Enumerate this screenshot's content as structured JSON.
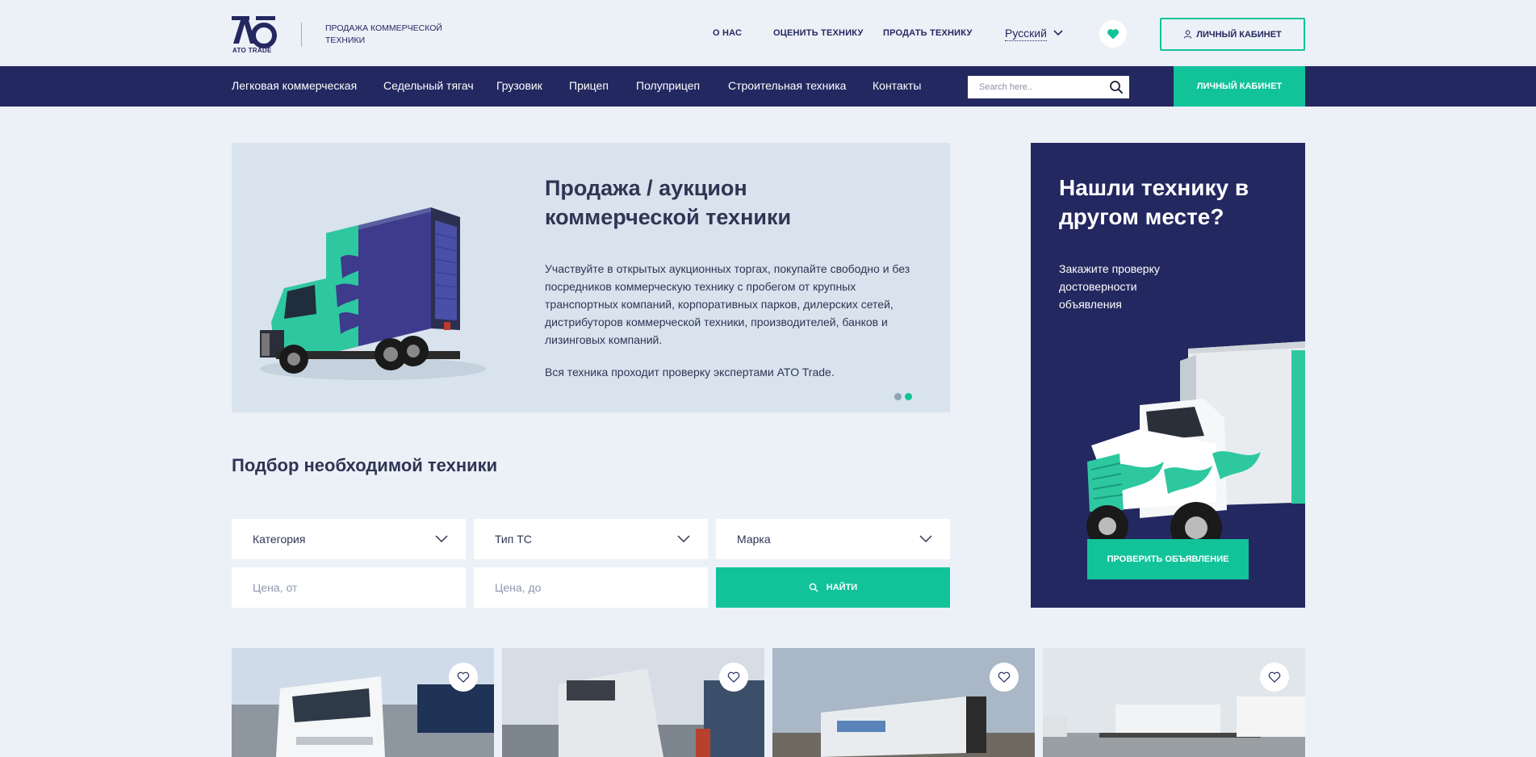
{
  "header": {
    "logo_text": "АТО",
    "logo_sub": "ATO TRADE",
    "tagline": "ПРОДАЖА КОММЕРЧЕСКОЙ ТЕХНИКИ",
    "links": [
      "О НАС",
      "ОЦЕНИТЬ ТЕХНИКУ",
      "ПРОДАТЬ ТЕХНИКУ"
    ],
    "language": "Русский",
    "cabinet_label": "ЛИЧНЫЙ КАБИНЕТ"
  },
  "nav": {
    "items": [
      "Легковая коммерческая",
      "Седельный тягач",
      "Грузовик",
      "Прицеп",
      "Полуприцеп",
      "Строительная техника",
      "Контакты"
    ],
    "search_placeholder": "Search here..",
    "cabinet_label": "ЛИЧНЫЙ КАБИНЕТ"
  },
  "hero": {
    "title": "Продажа / аукцион коммерческой техники",
    "text": "Участвуйте в открытых аукционных торгах, покупайте свободно и без посредников коммерческую технику с пробегом от крупных транспортных компаний, корпоративных парков, дилерских сетей, дистрибуторов коммерческой техники, производителей, банков и лизинговых компаний.",
    "text2": "Вся техника проходит проверку экспертами ATO Trade.",
    "slides_total": 2,
    "active_slide": 2
  },
  "promo": {
    "title": "Нашли технику в другом месте?",
    "text": "Закажите проверку достоверности объявления",
    "button": "ПРОВЕРИТЬ ОБЪЯВЛЕНИЕ"
  },
  "filter": {
    "title": "Подбор необходимой техники",
    "category": "Категория",
    "vehicle_type": "Тип ТС",
    "brand": "Марка",
    "price_from_placeholder": "Цена, от",
    "price_to_placeholder": "Цена, до",
    "find_button": "НАЙТИ"
  },
  "colors": {
    "navy": "#232860",
    "accent": "#12c39a",
    "background": "#ecf1f8"
  },
  "icons": [
    "heart-icon",
    "user-icon",
    "chevron-down-icon",
    "search-icon"
  ]
}
